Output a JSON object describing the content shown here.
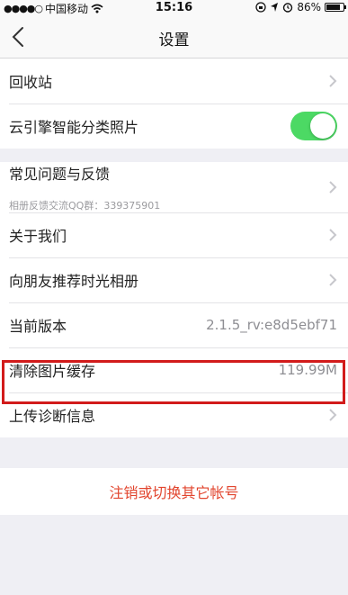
{
  "status_bar": {
    "signal_dots": "●●●●○",
    "carrier": "中国移动",
    "time": "15:16",
    "battery_percent": "86%",
    "battery_level": 0.86
  },
  "nav": {
    "title": "设置"
  },
  "group1": {
    "recycle_bin": "回收站",
    "cloud_classify": "云引擎智能分类照片",
    "cloud_classify_enabled": true
  },
  "group2": {
    "faq": "常见问题与反馈",
    "faq_sub": "相册反馈交流QQ群：339375901",
    "about": "关于我们",
    "recommend": "向朋友推荐时光相册",
    "version_label": "当前版本",
    "version_value": "2.1.5_rv:e8d5ebf71",
    "clear_cache_label": "清除图片缓存",
    "clear_cache_value": "119.99M",
    "upload_diag": "上传诊断信息"
  },
  "logout": {
    "label": "注销或切换其它帐号"
  },
  "colors": {
    "accent_red": "#e2452e",
    "toggle_on": "#4cd964",
    "highlight_box": "#d21b1b"
  },
  "icons": [
    "back-icon",
    "wifi-icon",
    "lock-rotation-icon",
    "location-icon",
    "alarm-icon",
    "battery-icon",
    "chevron-right-icon"
  ]
}
